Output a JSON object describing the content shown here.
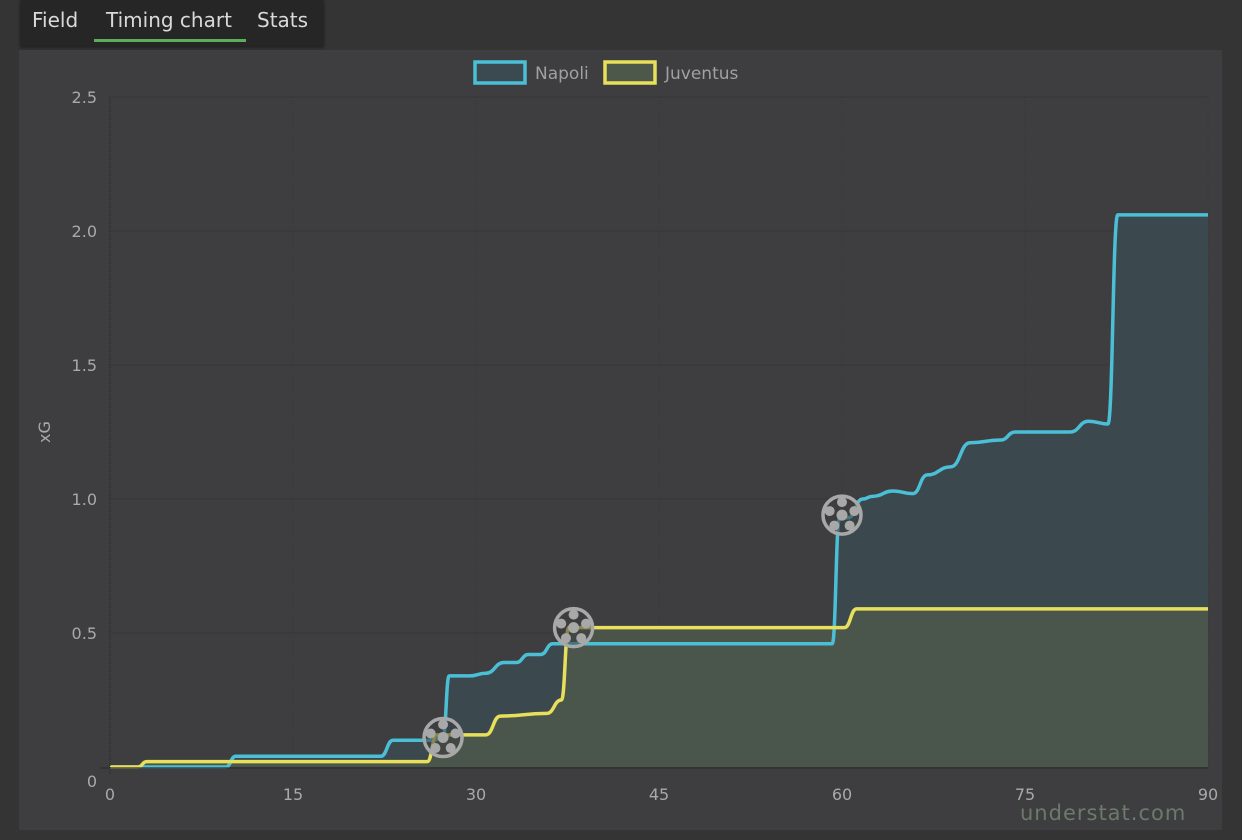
{
  "tabs": [
    {
      "label": "Field",
      "active": false
    },
    {
      "label": "Timing chart",
      "active": true
    },
    {
      "label": "Stats",
      "active": false
    }
  ],
  "colors": {
    "napoli": "#4bbfd6",
    "juventus": "#e8e05a",
    "napoli_fill": "#3b4a50",
    "juventus_fill": "#4d574a",
    "tab_underline": "#5cae58"
  },
  "watermark": "understat.com",
  "chart_data": {
    "type": "line",
    "title": "",
    "xlabel": "",
    "ylabel": "xG",
    "xlim": [
      0,
      90
    ],
    "ylim": [
      0,
      2.5
    ],
    "x_ticks": [
      0,
      15,
      30,
      45,
      60,
      75,
      90
    ],
    "x_tick_labels": [
      "0",
      "15",
      "30",
      "45",
      "60",
      "75",
      "90"
    ],
    "y_ticks": [
      0,
      0.5,
      1.0,
      1.5,
      2.0,
      2.5
    ],
    "y_tick_labels": [
      "0",
      "0.5",
      "1.0",
      "1.5",
      "2.0",
      "2.5"
    ],
    "grid": true,
    "legend_position": "top-center",
    "area_fill": true,
    "series": [
      {
        "name": "Napoli",
        "color": "#4bbfd6",
        "points": [
          [
            0,
            0
          ],
          [
            9.5,
            0
          ],
          [
            10.3,
            0.04
          ],
          [
            22.2,
            0.04
          ],
          [
            23.2,
            0.1
          ],
          [
            26.5,
            0.1
          ],
          [
            27.3,
            0.11
          ],
          [
            27.8,
            0.34
          ],
          [
            29.5,
            0.34
          ],
          [
            30.8,
            0.35
          ],
          [
            32.3,
            0.39
          ],
          [
            33.3,
            0.39
          ],
          [
            34.3,
            0.42
          ],
          [
            35.3,
            0.42
          ],
          [
            36.3,
            0.46
          ],
          [
            38.0,
            0.46
          ],
          [
            59.0,
            0.46
          ],
          [
            59.2,
            0.46
          ],
          [
            59.8,
            0.93
          ],
          [
            60.5,
            0.93
          ],
          [
            61.7,
            1.0
          ],
          [
            62.5,
            1.01
          ],
          [
            64.2,
            1.03
          ],
          [
            65.8,
            1.02
          ],
          [
            67.0,
            1.09
          ],
          [
            68.9,
            1.12
          ],
          [
            70.5,
            1.21
          ],
          [
            73.0,
            1.22
          ],
          [
            74.2,
            1.25
          ],
          [
            78.7,
            1.25
          ],
          [
            80.2,
            1.29
          ],
          [
            81.8,
            1.28
          ],
          [
            82.6,
            2.06
          ],
          [
            83.5,
            2.06
          ],
          [
            90,
            2.06
          ]
        ]
      },
      {
        "name": "Juventus",
        "color": "#e8e05a",
        "points": [
          [
            0,
            0
          ],
          [
            2.3,
            0
          ],
          [
            3.0,
            0.02
          ],
          [
            26.0,
            0.02
          ],
          [
            26.8,
            0.12
          ],
          [
            30.8,
            0.12
          ],
          [
            32.0,
            0.19
          ],
          [
            35.8,
            0.2
          ],
          [
            37.0,
            0.25
          ],
          [
            37.6,
            0.52
          ],
          [
            59.5,
            0.52
          ],
          [
            60.2,
            0.52
          ],
          [
            61.2,
            0.59
          ],
          [
            90,
            0.59
          ]
        ]
      }
    ],
    "goal_markers": [
      {
        "team": "Napoli",
        "minute": 27.3,
        "xg": 0.11
      },
      {
        "team": "Juventus",
        "minute": 38.0,
        "xg": 0.52
      },
      {
        "team": "Napoli",
        "minute": 60.0,
        "xg": 0.94
      }
    ]
  }
}
